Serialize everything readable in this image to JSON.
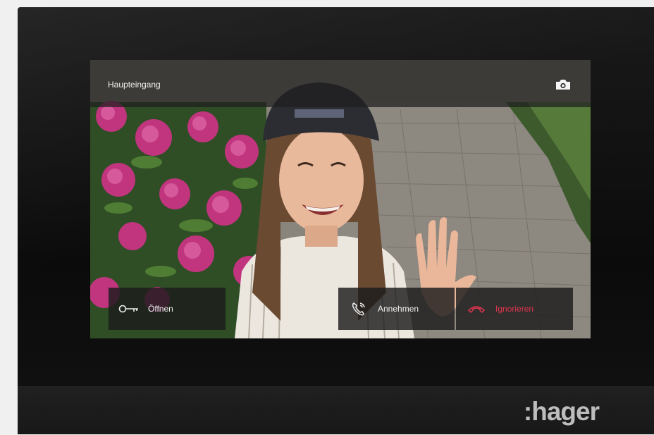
{
  "screen": {
    "title": "Haupteingang",
    "camera_button": "camera-icon"
  },
  "actions": {
    "open_label": "Öffnen",
    "open_icon": "key-icon",
    "accept_label": "Annehmen",
    "accept_icon": "phone-ringing-icon",
    "ignore_label": "Ignorieren",
    "ignore_icon": "hang-up-icon"
  },
  "branding": {
    "logo_text": ":hager"
  },
  "colors": {
    "accent_reject": "#e2344f",
    "text_light": "#f2f2f2"
  }
}
